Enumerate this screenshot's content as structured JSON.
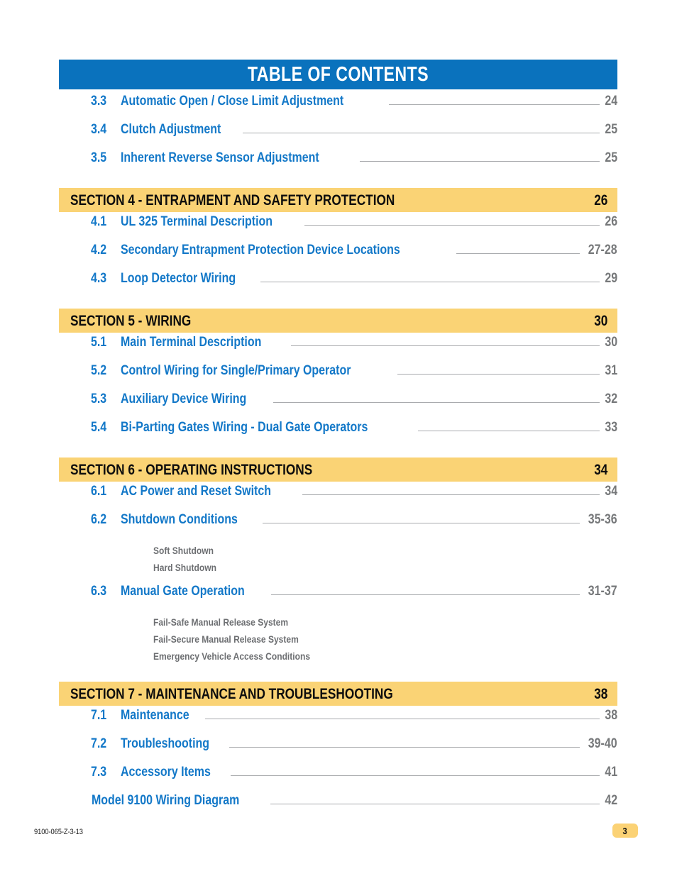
{
  "header": {
    "title": "TABLE OF CONTENTS",
    "bar_color": "#0a72bd"
  },
  "colors": {
    "header_blue": "#0a72bd",
    "section_yellow": "#fad375",
    "entry_blue": "#1378c8",
    "page_gray": "#76787a",
    "subitem_gray": "#6d6f72",
    "leader_gray": "#a9abae"
  },
  "contents": [
    {
      "kind": "entry",
      "number": "3.3",
      "title": "Automatic Open / Close Limit  Adjustment",
      "page": "24"
    },
    {
      "kind": "entry",
      "number": "3.4",
      "title": "Clutch Adjustment",
      "page": "25"
    },
    {
      "kind": "entry",
      "number": "3.5",
      "title": "Inherent Reverse Sensor Adjustment",
      "page": "25"
    },
    {
      "kind": "section",
      "title": "SECTION 4 - ENTRAPMENT AND SAFETY PROTECTION",
      "page": "26"
    },
    {
      "kind": "entry",
      "number": "4.1",
      "title": "UL 325 Terminal Description",
      "page": "26"
    },
    {
      "kind": "entry",
      "number": "4.2",
      "title": "Secondary Entrapment Protection Device Locations",
      "page": "27-28"
    },
    {
      "kind": "entry",
      "number": "4.3",
      "title": "Loop Detector Wiring",
      "page": "29"
    },
    {
      "kind": "section",
      "title": "SECTION 5 - WIRING",
      "page": "30"
    },
    {
      "kind": "entry",
      "number": "5.1",
      "title": "Main Terminal Description",
      "page": "30"
    },
    {
      "kind": "entry",
      "number": "5.2",
      "title": "Control Wiring for Single/Primary Operator",
      "page": "31"
    },
    {
      "kind": "entry",
      "number": "5.3",
      "title": "Auxiliary Device Wiring",
      "page": "32"
    },
    {
      "kind": "entry",
      "number": "5.4",
      "title": "Bi-Parting Gates Wiring - Dual Gate Operators",
      "page": "33"
    },
    {
      "kind": "section",
      "title": "SECTION 6 - OPERATING INSTRUCTIONS",
      "page": "34"
    },
    {
      "kind": "entry",
      "number": "6.1",
      "title": "AC Power and Reset Switch",
      "page": "34"
    },
    {
      "kind": "entry",
      "number": "6.2",
      "title": "Shutdown Conditions",
      "page": "35-36",
      "subitems": [
        "Soft Shutdown",
        "Hard Shutdown"
      ]
    },
    {
      "kind": "entry",
      "number": "6.3",
      "title": "Manual Gate Operation",
      "page": "31-37",
      "subitems": [
        "Fail-Safe Manual Release System",
        "Fail-Secure Manual Release System",
        "Emergency Vehicle Access Conditions"
      ]
    },
    {
      "kind": "section",
      "title": "SECTION 7 - MAINTENANCE AND TROUBLESHOOTING",
      "page": "38"
    },
    {
      "kind": "entry",
      "number": "7.1",
      "title": "Maintenance",
      "page": "38"
    },
    {
      "kind": "entry",
      "number": "7.2",
      "title": "Troubleshooting",
      "page": "39-40"
    },
    {
      "kind": "entry",
      "number": "7.3",
      "title": "Accessory Items",
      "page": "41"
    },
    {
      "kind": "entry",
      "number": "",
      "title": "Model 9100 Wiring Diagram",
      "page": "42"
    }
  ],
  "footer": {
    "document_code": "9100-065-Z-3-13",
    "page_number": "3"
  }
}
